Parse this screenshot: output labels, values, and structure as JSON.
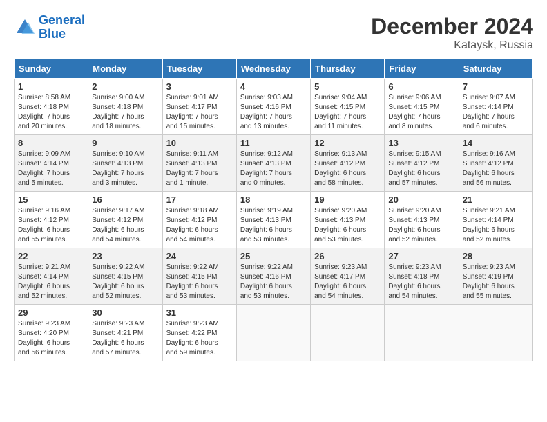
{
  "header": {
    "logo_line1": "General",
    "logo_line2": "Blue",
    "month_year": "December 2024",
    "location": "Kataysk, Russia"
  },
  "days_of_week": [
    "Sunday",
    "Monday",
    "Tuesday",
    "Wednesday",
    "Thursday",
    "Friday",
    "Saturday"
  ],
  "weeks": [
    [
      {
        "day": "1",
        "info": "Sunrise: 8:58 AM\nSunset: 4:18 PM\nDaylight: 7 hours\nand 20 minutes."
      },
      {
        "day": "2",
        "info": "Sunrise: 9:00 AM\nSunset: 4:18 PM\nDaylight: 7 hours\nand 18 minutes."
      },
      {
        "day": "3",
        "info": "Sunrise: 9:01 AM\nSunset: 4:17 PM\nDaylight: 7 hours\nand 15 minutes."
      },
      {
        "day": "4",
        "info": "Sunrise: 9:03 AM\nSunset: 4:16 PM\nDaylight: 7 hours\nand 13 minutes."
      },
      {
        "day": "5",
        "info": "Sunrise: 9:04 AM\nSunset: 4:15 PM\nDaylight: 7 hours\nand 11 minutes."
      },
      {
        "day": "6",
        "info": "Sunrise: 9:06 AM\nSunset: 4:15 PM\nDaylight: 7 hours\nand 8 minutes."
      },
      {
        "day": "7",
        "info": "Sunrise: 9:07 AM\nSunset: 4:14 PM\nDaylight: 7 hours\nand 6 minutes."
      }
    ],
    [
      {
        "day": "8",
        "info": "Sunrise: 9:09 AM\nSunset: 4:14 PM\nDaylight: 7 hours\nand 5 minutes."
      },
      {
        "day": "9",
        "info": "Sunrise: 9:10 AM\nSunset: 4:13 PM\nDaylight: 7 hours\nand 3 minutes."
      },
      {
        "day": "10",
        "info": "Sunrise: 9:11 AM\nSunset: 4:13 PM\nDaylight: 7 hours\nand 1 minute."
      },
      {
        "day": "11",
        "info": "Sunrise: 9:12 AM\nSunset: 4:13 PM\nDaylight: 7 hours\nand 0 minutes."
      },
      {
        "day": "12",
        "info": "Sunrise: 9:13 AM\nSunset: 4:12 PM\nDaylight: 6 hours\nand 58 minutes."
      },
      {
        "day": "13",
        "info": "Sunrise: 9:15 AM\nSunset: 4:12 PM\nDaylight: 6 hours\nand 57 minutes."
      },
      {
        "day": "14",
        "info": "Sunrise: 9:16 AM\nSunset: 4:12 PM\nDaylight: 6 hours\nand 56 minutes."
      }
    ],
    [
      {
        "day": "15",
        "info": "Sunrise: 9:16 AM\nSunset: 4:12 PM\nDaylight: 6 hours\nand 55 minutes."
      },
      {
        "day": "16",
        "info": "Sunrise: 9:17 AM\nSunset: 4:12 PM\nDaylight: 6 hours\nand 54 minutes."
      },
      {
        "day": "17",
        "info": "Sunrise: 9:18 AM\nSunset: 4:12 PM\nDaylight: 6 hours\nand 54 minutes."
      },
      {
        "day": "18",
        "info": "Sunrise: 9:19 AM\nSunset: 4:13 PM\nDaylight: 6 hours\nand 53 minutes."
      },
      {
        "day": "19",
        "info": "Sunrise: 9:20 AM\nSunset: 4:13 PM\nDaylight: 6 hours\nand 53 minutes."
      },
      {
        "day": "20",
        "info": "Sunrise: 9:20 AM\nSunset: 4:13 PM\nDaylight: 6 hours\nand 52 minutes."
      },
      {
        "day": "21",
        "info": "Sunrise: 9:21 AM\nSunset: 4:14 PM\nDaylight: 6 hours\nand 52 minutes."
      }
    ],
    [
      {
        "day": "22",
        "info": "Sunrise: 9:21 AM\nSunset: 4:14 PM\nDaylight: 6 hours\nand 52 minutes."
      },
      {
        "day": "23",
        "info": "Sunrise: 9:22 AM\nSunset: 4:15 PM\nDaylight: 6 hours\nand 52 minutes."
      },
      {
        "day": "24",
        "info": "Sunrise: 9:22 AM\nSunset: 4:15 PM\nDaylight: 6 hours\nand 53 minutes."
      },
      {
        "day": "25",
        "info": "Sunrise: 9:22 AM\nSunset: 4:16 PM\nDaylight: 6 hours\nand 53 minutes."
      },
      {
        "day": "26",
        "info": "Sunrise: 9:23 AM\nSunset: 4:17 PM\nDaylight: 6 hours\nand 54 minutes."
      },
      {
        "day": "27",
        "info": "Sunrise: 9:23 AM\nSunset: 4:18 PM\nDaylight: 6 hours\nand 54 minutes."
      },
      {
        "day": "28",
        "info": "Sunrise: 9:23 AM\nSunset: 4:19 PM\nDaylight: 6 hours\nand 55 minutes."
      }
    ],
    [
      {
        "day": "29",
        "info": "Sunrise: 9:23 AM\nSunset: 4:20 PM\nDaylight: 6 hours\nand 56 minutes."
      },
      {
        "day": "30",
        "info": "Sunrise: 9:23 AM\nSunset: 4:21 PM\nDaylight: 6 hours\nand 57 minutes."
      },
      {
        "day": "31",
        "info": "Sunrise: 9:23 AM\nSunset: 4:22 PM\nDaylight: 6 hours\nand 59 minutes."
      },
      {
        "day": "",
        "info": ""
      },
      {
        "day": "",
        "info": ""
      },
      {
        "day": "",
        "info": ""
      },
      {
        "day": "",
        "info": ""
      }
    ]
  ]
}
